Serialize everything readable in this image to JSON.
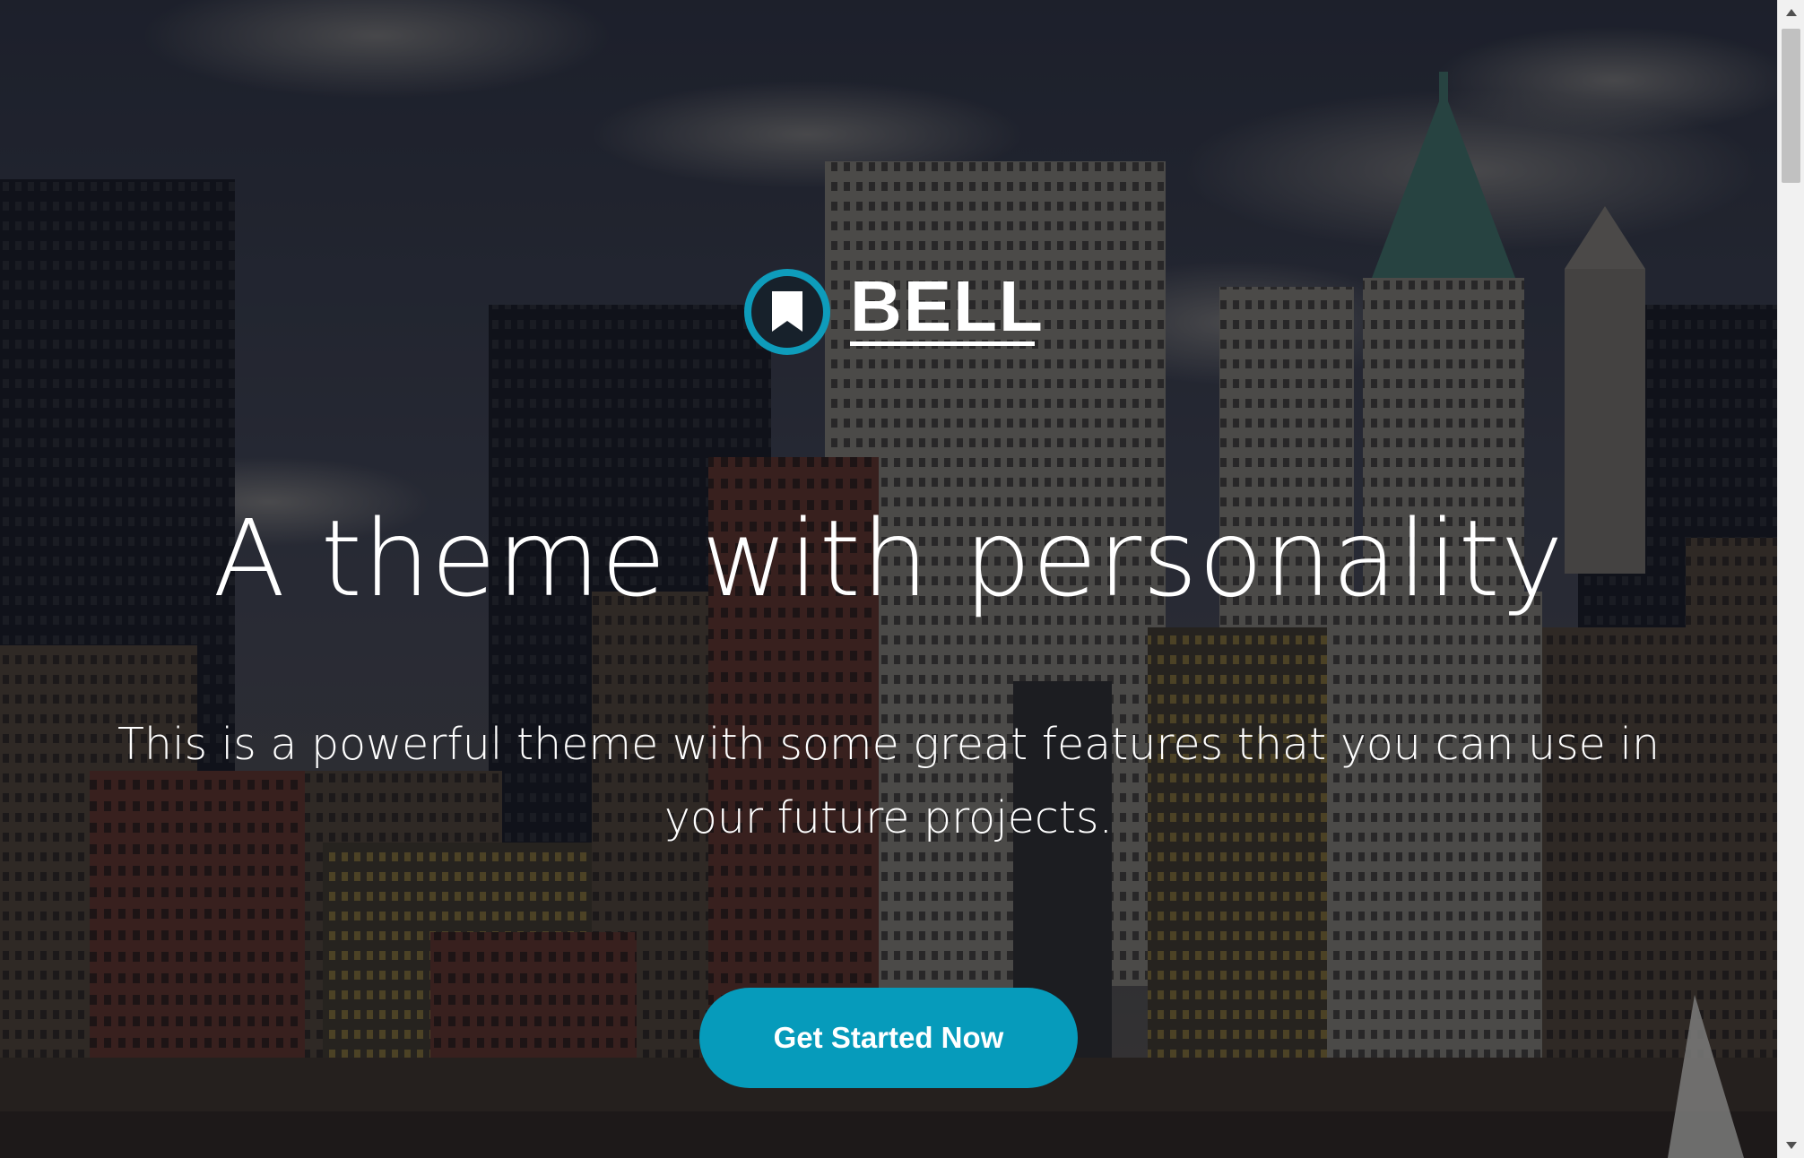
{
  "logo": {
    "text": "BELL",
    "ring_color": "#0e9cbb"
  },
  "hero": {
    "headline": "A theme with personality",
    "subtitle": "This is a powerful theme with some great features that you can use in your future projects.",
    "cta_label": "Get Started Now",
    "cta_color": "#069bbb"
  },
  "scrollbar": {
    "up_icon": "triangle-up-icon",
    "down_icon": "triangle-down-icon"
  }
}
